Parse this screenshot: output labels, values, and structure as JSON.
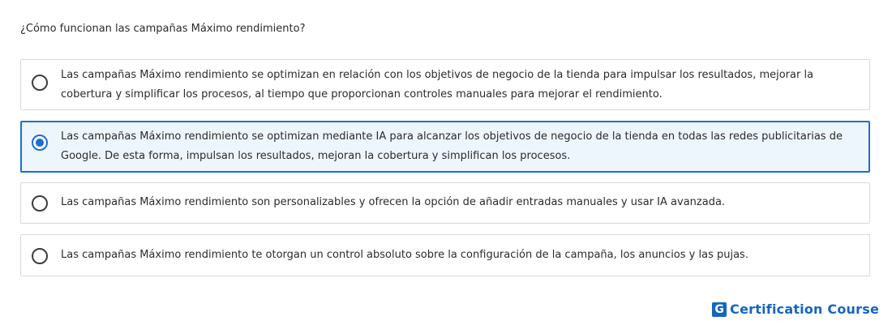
{
  "question": {
    "text": "¿Cómo funcionan las campañas Máximo rendimiento?"
  },
  "options": [
    {
      "text": "Las campañas Máximo rendimiento se optimizan en relación con los objetivos de negocio de la tienda para impulsar los resultados, mejorar la cobertura y simplificar los procesos, al tiempo que proporcionan controles manuales para mejorar el rendimiento.",
      "selected": false
    },
    {
      "text": "Las campañas Máximo rendimiento se optimizan mediante IA para alcanzar los objetivos de negocio de la tienda en todas las redes publicitarias de Google. De esta forma, impulsan los resultados, mejoran la cobertura y simplifican los procesos.",
      "selected": true
    },
    {
      "text": "Las campañas Máximo rendimiento son personalizables y ofrecen la opción de añadir entradas manuales y usar IA avanzada.",
      "selected": false
    },
    {
      "text": "Las campañas Máximo rendimiento te otorgan un control absoluto sobre la configuración de la campaña, los anuncios y las pujas.",
      "selected": false
    }
  ],
  "brand": {
    "logo_letter": "G",
    "name": "Certification Course",
    "color": "#1565c0"
  },
  "colors": {
    "accent": "#1a6fd0",
    "selected_background": "#eef6fd",
    "border": "#d9d9d9"
  }
}
